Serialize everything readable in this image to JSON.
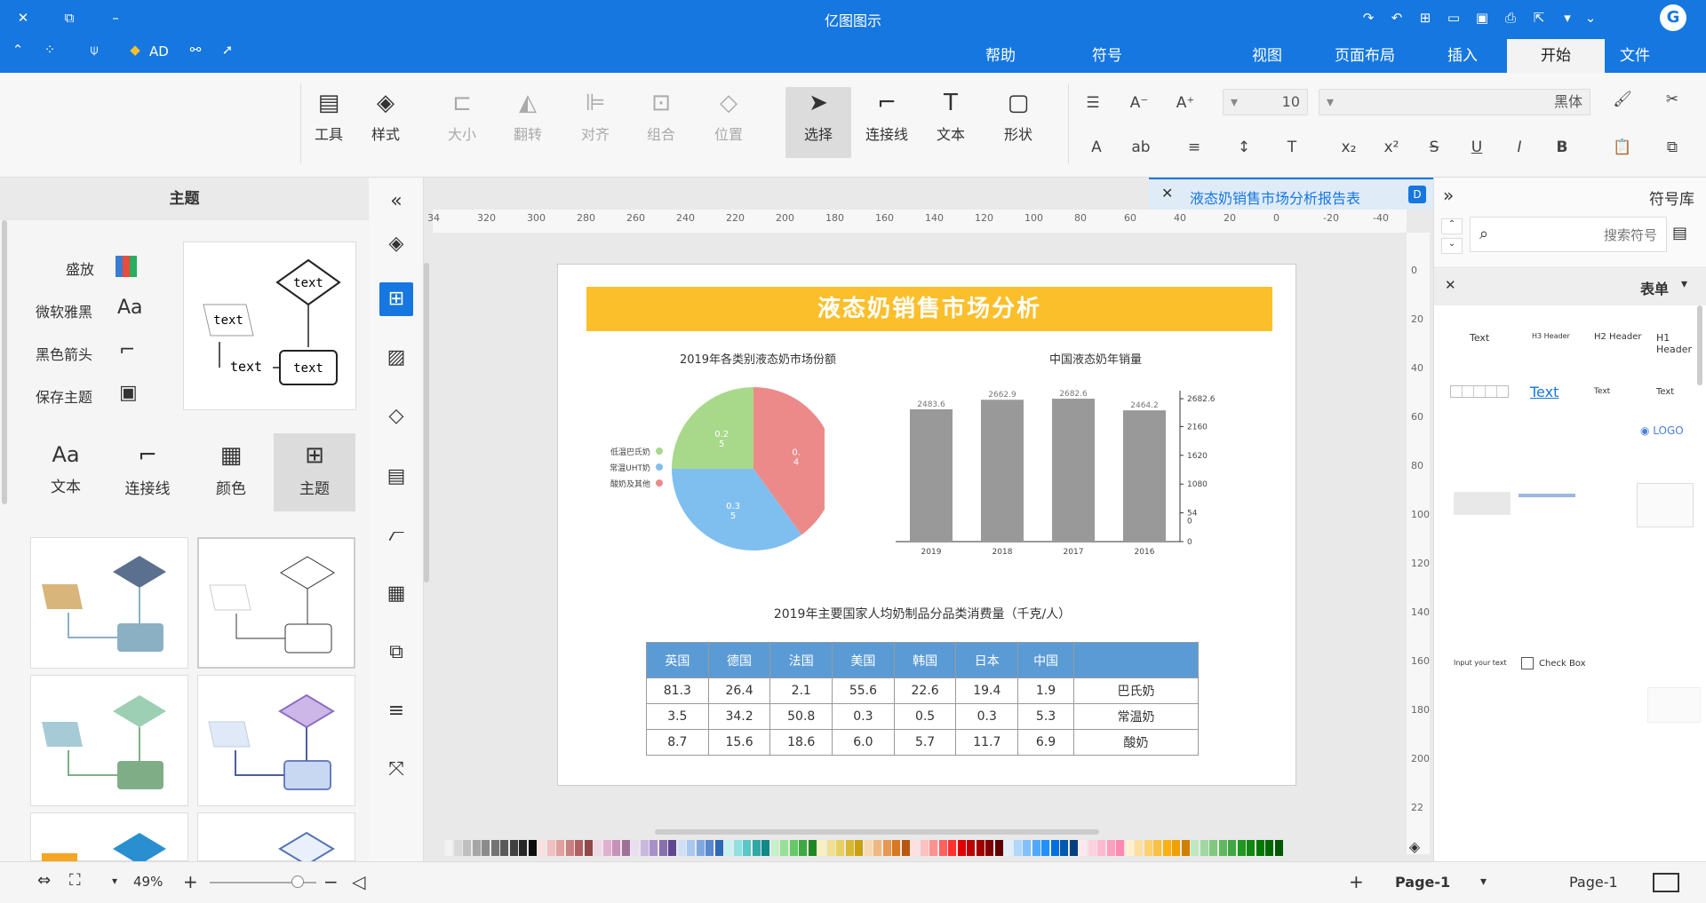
{
  "window": {
    "title": "亿图图示"
  },
  "tabs": [
    "文件",
    "开始",
    "插入",
    "页面布局",
    "视图",
    "符号",
    "帮助"
  ],
  "active_tab": "开始",
  "topbar": {
    "ad_label": "AD"
  },
  "ribbon": {
    "tools": [
      "形状",
      "文本",
      "连接线",
      "选择",
      "位置",
      "组合",
      "对齐",
      "翻转",
      "大小",
      "样式",
      "工具"
    ],
    "font_name": "黑体",
    "font_size": "10"
  },
  "left_panel": {
    "title": "主题",
    "options": [
      "盛放",
      "微软雅黑",
      "黑色箭头",
      "保存主题"
    ],
    "tabs": [
      "主题",
      "颜色",
      "连接线",
      "文本"
    ],
    "preview_text": "text"
  },
  "document_tab": {
    "title": "液态奶销售市场分析报告表"
  },
  "ruler": {
    "h_ticks": [
      "-40",
      "-20",
      "0",
      "20",
      "40",
      "60",
      "80",
      "100",
      "120",
      "140",
      "160",
      "180",
      "200",
      "220",
      "240",
      "260",
      "280",
      "300",
      "320",
      "34"
    ],
    "v_ticks": [
      "0",
      "20",
      "40",
      "60",
      "80",
      "100",
      "120",
      "140",
      "160",
      "180",
      "200",
      "22"
    ]
  },
  "page": {
    "banner_title": "液态奶销售市场分析",
    "pie_title": "2019年各类别液态奶市场份额",
    "bar_title": "中国液态奶年销量",
    "table_title": "2019年主要国家人均奶制品分品类消费量（千克/人）"
  },
  "chart_data": [
    {
      "type": "pie",
      "title": "2019年各类别液态奶市场份额",
      "labels": [
        "低温巴氏奶",
        "常温UHT奶",
        "酸奶及其他"
      ],
      "values": [
        0.25,
        0.35,
        0.4
      ],
      "colors": [
        "#a8d98a",
        "#7fbff0",
        "#ec8a8a"
      ],
      "value_labels": [
        "0.2\n5",
        "0.3\n5",
        "0.\n4"
      ]
    },
    {
      "type": "bar",
      "title": "中国液态奶年销量",
      "categories": [
        "2016",
        "2017",
        "2018",
        "2019"
      ],
      "values": [
        2464.2,
        2682.6,
        2662.9,
        2483.6
      ],
      "value_labels": [
        "2464.2",
        "2682.6",
        "2662.9",
        "2483.6"
      ],
      "yticks": [
        "0",
        "54\n0",
        "1080",
        "1620",
        "2160",
        "2682.6"
      ],
      "ylim": [
        0,
        2700
      ],
      "color": "#999999"
    },
    {
      "type": "table",
      "title": "2019年主要国家人均奶制品分品类消费量（千克/人）",
      "header": [
        "",
        "中国",
        "日本",
        "韩国",
        "美国",
        "法国",
        "德国",
        "英国"
      ],
      "rows": [
        [
          "巴氏奶",
          "1.9",
          "19.4",
          "22.6",
          "55.6",
          "2.1",
          "26.4",
          "81.3"
        ],
        [
          "常温奶",
          "5.3",
          "0.3",
          "0.5",
          "0.3",
          "50.8",
          "34.2",
          "3.5"
        ],
        [
          "酸奶",
          "6.9",
          "11.7",
          "5.7",
          "6.0",
          "18.6",
          "15.6",
          "8.7"
        ]
      ]
    }
  ],
  "right_panel": {
    "title": "符号库",
    "search_placeholder": "搜索符号",
    "section": "表单",
    "items": [
      "H1 Header",
      "H2 Header",
      "H3 Header",
      "Text",
      "Text",
      "Text",
      "Text",
      "Check Box",
      "Input your text"
    ]
  },
  "status": {
    "page_tab": "Page-1",
    "page_label": "Page-1",
    "zoom": "49%"
  },
  "colors": {
    "accent": "#1677e0",
    "banner": "#fbbf2c",
    "table_header": "#5b9bd5"
  }
}
